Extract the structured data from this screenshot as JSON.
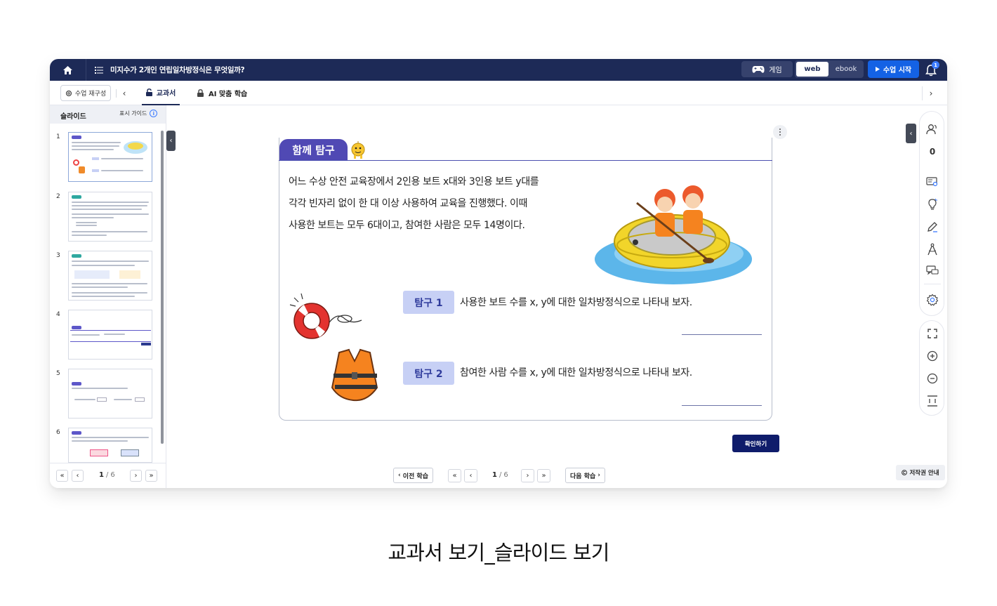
{
  "topbar": {
    "lesson_title": "미지수가 2개인 연립일차방정식은 무엇일까?",
    "game_label": "게임",
    "mode_web": "web",
    "mode_ebook": "ebook",
    "start_label": "수업 시작",
    "notification_count": "1"
  },
  "subbar": {
    "reconfigure_label": "수업 재구성",
    "tab_textbook": "교과서",
    "tab_ai": "AI 맞춤 학습"
  },
  "sidebar": {
    "title": "슬라이드",
    "guide_label": "표시 가이드",
    "slides": [
      "1",
      "2",
      "3",
      "4",
      "5",
      "6"
    ],
    "pager": {
      "current": "1",
      "separator": "/",
      "total": "6"
    }
  },
  "slide": {
    "header_tab": "함께 탐구",
    "paragraph": [
      "어느 수상 안전 교육장에서 2인용 보트 x대와 3인용 보트 y대를",
      "각각 빈자리 없이 한 대 이상 사용하여 교육을 진행했다. 이때",
      "사용한 보트는 모두 6대이고, 참여한 사람은 모두 14명이다."
    ],
    "questions": [
      {
        "label": "탐구 1",
        "text": "사용한 보트 수를 x, y에 대한 일차방정식으로 나타내 보자."
      },
      {
        "label": "탐구 2",
        "text": "참여한 사람 수를 x, y에 대한 일차방정식으로 나타내 보자."
      }
    ],
    "confirm_label": "확인하기"
  },
  "tools": {
    "participant_count": "0"
  },
  "bottom": {
    "prev_lesson": "이전 학습",
    "next_lesson": "다음 학습",
    "pager": {
      "current": "1",
      "separator": "/",
      "total": "6"
    },
    "copyright": "저작권 안내"
  },
  "caption": "교과서 보기_슬라이드 보기",
  "colors": {
    "navy": "#1d2a57",
    "accent_blue": "#1462e5",
    "header_purple": "#5049b4",
    "question_badge": "#c7d0f5",
    "confirm": "#0f1c6b"
  }
}
